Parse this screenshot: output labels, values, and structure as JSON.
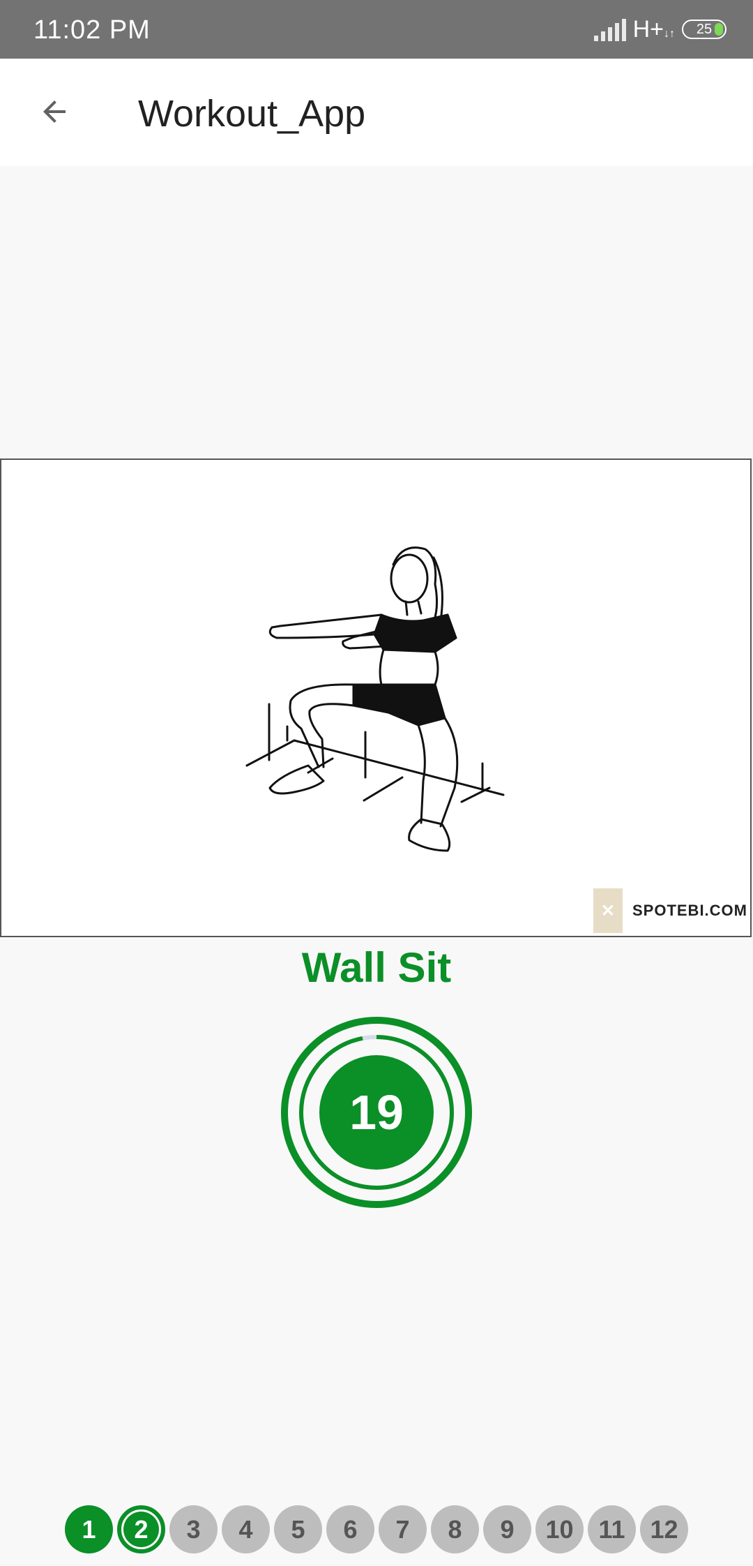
{
  "status_bar": {
    "time": "11:02 PM",
    "network": "H+",
    "battery_level": "25"
  },
  "app_bar": {
    "title": "Workout_App",
    "back_icon": "arrow-back-icon"
  },
  "exercise": {
    "name": "Wall Sit",
    "image_watermark": "SPOTEBI.COM",
    "timer_value": "19",
    "timer_progress": 0.97
  },
  "progress_steps": [
    {
      "label": "1",
      "state": "done"
    },
    {
      "label": "2",
      "state": "current"
    },
    {
      "label": "3",
      "state": "upcoming"
    },
    {
      "label": "4",
      "state": "upcoming"
    },
    {
      "label": "5",
      "state": "upcoming"
    },
    {
      "label": "6",
      "state": "upcoming"
    },
    {
      "label": "7",
      "state": "upcoming"
    },
    {
      "label": "8",
      "state": "upcoming"
    },
    {
      "label": "9",
      "state": "upcoming"
    },
    {
      "label": "10",
      "state": "upcoming"
    },
    {
      "label": "11",
      "state": "upcoming"
    },
    {
      "label": "12",
      "state": "upcoming"
    }
  ],
  "colors": {
    "accent": "#0b8f27",
    "inactive": "#bdbdbd",
    "status_bar": "#737373"
  }
}
